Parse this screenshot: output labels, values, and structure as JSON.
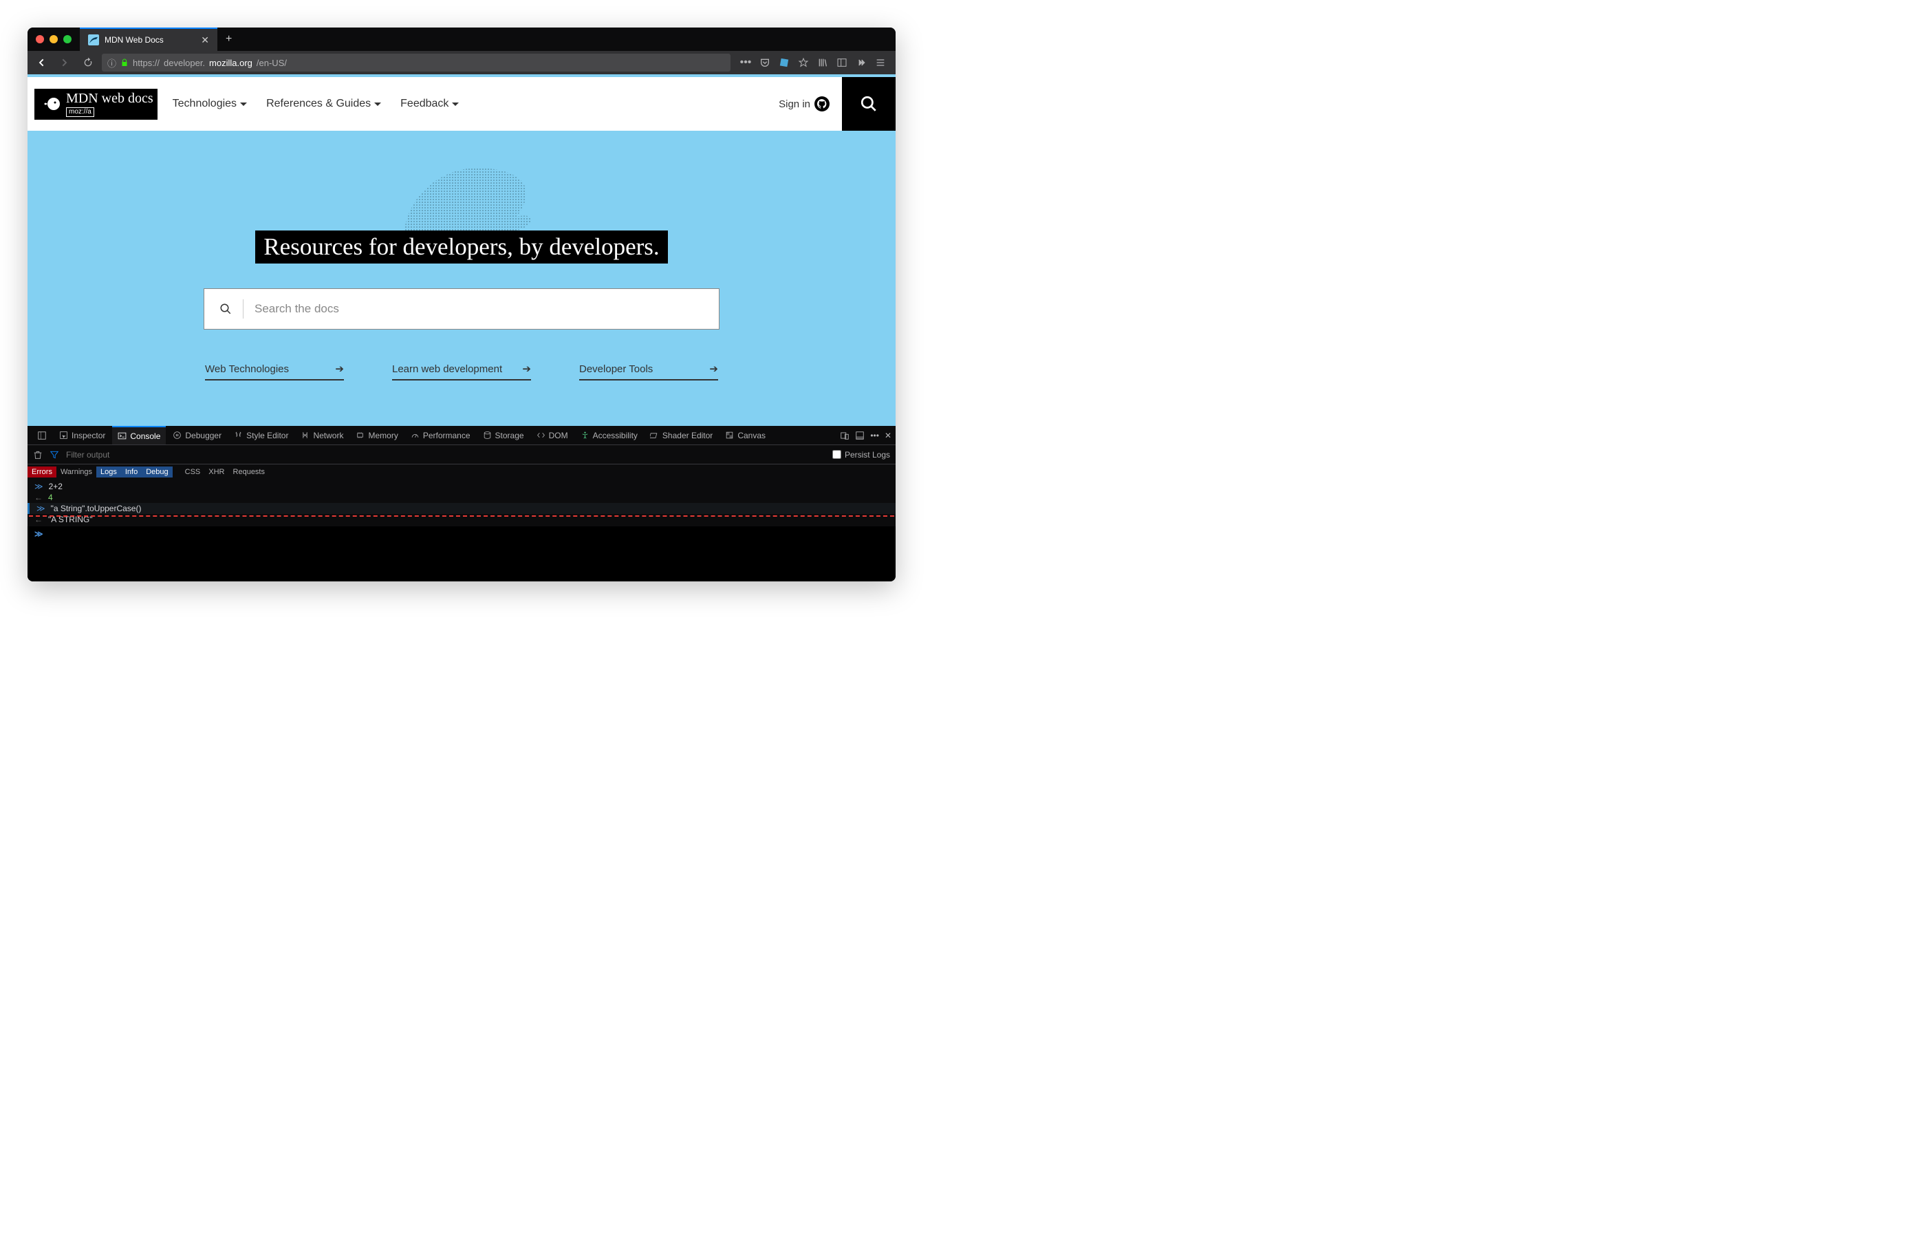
{
  "window": {
    "tab_title": "MDN Web Docs"
  },
  "url": {
    "protocol": "https://",
    "pre_host": "developer.",
    "host": "mozilla.org",
    "path": "/en-US/"
  },
  "header": {
    "logo_main": "MDN web docs",
    "logo_sub": "moz://a",
    "nav": [
      "Technologies",
      "References & Guides",
      "Feedback"
    ],
    "signin": "Sign in"
  },
  "hero": {
    "title": "Resources for developers, by developers.",
    "search_placeholder": "Search the docs",
    "quick": [
      "Web Technologies",
      "Learn web development",
      "Developer Tools"
    ]
  },
  "devtools": {
    "tabs": [
      "Inspector",
      "Console",
      "Debugger",
      "Style Editor",
      "Network",
      "Memory",
      "Performance",
      "Storage",
      "DOM",
      "Accessibility",
      "Shader Editor",
      "Canvas"
    ],
    "active_tab": "Console",
    "filter_placeholder": "Filter output",
    "persist_label": "Persist Logs",
    "filters": {
      "errors": "Errors",
      "warnings": "Warnings",
      "logs": "Logs",
      "info": "Info",
      "debug": "Debug",
      "css": "CSS",
      "xhr": "XHR",
      "requests": "Requests"
    },
    "console": [
      {
        "kind": "in",
        "text": "2+2"
      },
      {
        "kind": "out",
        "text": "4",
        "type": "num"
      },
      {
        "kind": "in",
        "text": "\"a String\".toUpperCase()"
      },
      {
        "kind": "out",
        "text": "\"A STRING\"",
        "type": "str"
      }
    ]
  }
}
